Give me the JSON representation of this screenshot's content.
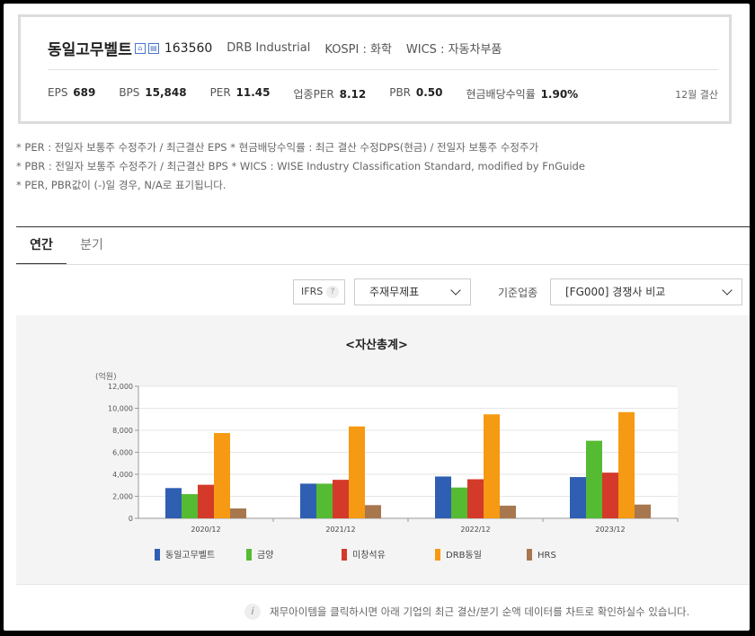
{
  "header": {
    "company": "동일고무벨트",
    "code": "163560",
    "name_en": "DRB Industrial",
    "market": "KOSPI : 화학",
    "wics": "WICS : 자동차부품",
    "settle": "12월 결산"
  },
  "metrics": [
    {
      "label": "EPS",
      "value": "689"
    },
    {
      "label": "BPS",
      "value": "15,848"
    },
    {
      "label": "PER",
      "value": "11.45"
    },
    {
      "label": "업종PER",
      "value": "8.12"
    },
    {
      "label": "PBR",
      "value": "0.50"
    },
    {
      "label": "현금배당수익률",
      "value": "1.90%"
    }
  ],
  "notes": [
    "* PER : 전일자 보통주 수정주가 / 최근결산 EPS * 현금배당수익률 : 최근 결산 수정DPS(현금) / 전일자 보통주 수정주가",
    "* PBR : 전일자 보통주 수정주가 / 최근결산 BPS * WICS : WISE Industry Classification Standard, modified by FnGuide",
    "* PER, PBR값이 (-)일 경우, N/A로 표기됩니다."
  ],
  "tabs": [
    "연간",
    "분기"
  ],
  "controls": {
    "ifrs": "IFRS",
    "help": "?",
    "statement": "주재무제표",
    "std_label": "기준업종",
    "std_value": "[FG000] 경쟁사 비교"
  },
  "info_text": "재무아이템을 클릭하시면 아래 기업의 최근 결산/분기 순액 데이터를 차트로 확인하실수 있습니다.",
  "info_icon": "i",
  "colors": {
    "s1": "#2f5fb3",
    "s2": "#55bb33",
    "s3": "#d33a2a",
    "s4": "#f59a12",
    "s5": "#a8774e"
  },
  "chart_data": {
    "type": "bar",
    "title": "<자산총계>",
    "unit": "(억원)",
    "ylim": [
      0,
      12000
    ],
    "yticks": [
      "0",
      "2,000",
      "4,000",
      "6,000",
      "8,000",
      "10,000",
      "12,000"
    ],
    "categories": [
      "2020/12",
      "2021/12",
      "2022/12",
      "2023/12"
    ],
    "legend_position": "bottom",
    "series": [
      {
        "name": "동일고무벨트",
        "values": [
          2750,
          3150,
          3800,
          3750
        ]
      },
      {
        "name": "금양",
        "values": [
          2200,
          3150,
          2800,
          7050
        ]
      },
      {
        "name": "미창석유",
        "values": [
          3050,
          3500,
          3550,
          4150
        ]
      },
      {
        "name": "DRB동일",
        "values": [
          7750,
          8350,
          9450,
          9650
        ]
      },
      {
        "name": "HRS",
        "values": [
          900,
          1200,
          1150,
          1250
        ]
      }
    ]
  }
}
